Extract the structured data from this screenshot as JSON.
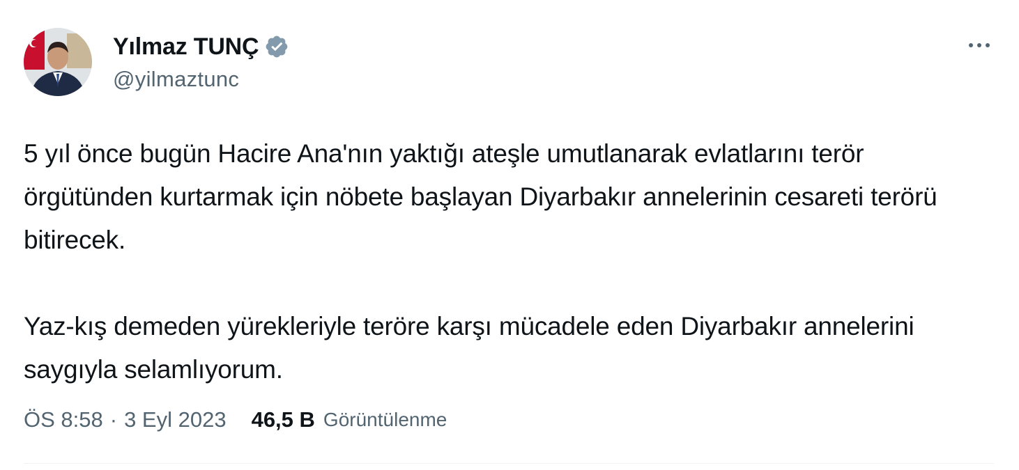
{
  "author": {
    "name": "Yılmaz TUNÇ",
    "handle": "@yilmaztunc",
    "verified_color": "#829aab"
  },
  "tweet": {
    "paragraphs": [
      "5 yıl önce bugün Hacire Ana'nın yaktığı ateşle umutlanarak evlatlarını terör örgütünden kurtarmak için nöbete başlayan Diyarbakır annelerinin cesareti terörü bitirecek.",
      "Yaz-kış demeden yürekleriyle teröre karşı mücadele eden Diyarbakır annelerini saygıyla selamlıyorum."
    ]
  },
  "meta": {
    "time": "ÖS 8:58",
    "separator": "·",
    "date": "3 Eyl 2023",
    "views_count": "46,5 B",
    "views_label": "Görüntülenme"
  },
  "icons": {
    "verified": "verified-badge-icon",
    "more": "more-options-icon"
  },
  "colors": {
    "text_primary": "#0f1419",
    "text_secondary": "#536471"
  }
}
